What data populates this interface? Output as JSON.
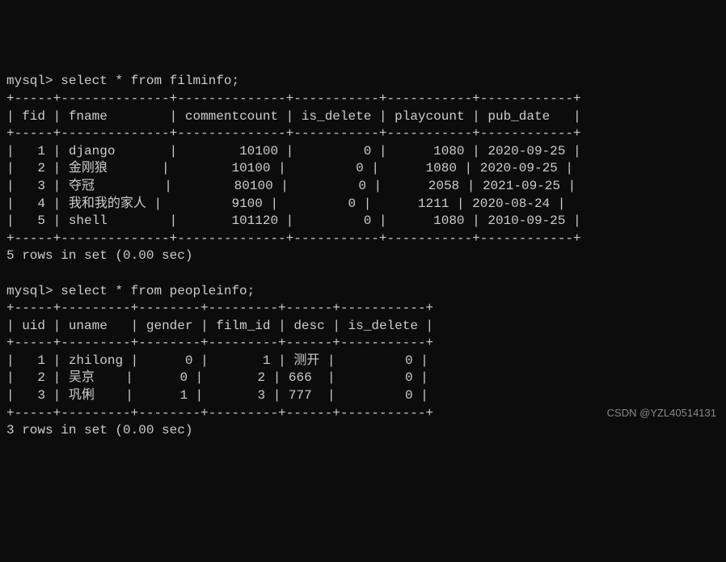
{
  "prompt": "mysql> ",
  "query1": {
    "sql": "select * from filminfo;",
    "columns": [
      "fid",
      "fname",
      "commentcount",
      "is_delete",
      "playcount",
      "pub_date"
    ],
    "rows": [
      {
        "fid": "1",
        "fname": "django",
        "commentcount": "10100",
        "is_delete": "0",
        "playcount": "1080",
        "pub_date": "2020-09-25"
      },
      {
        "fid": "2",
        "fname": "金刚狼",
        "commentcount": "10100",
        "is_delete": "0",
        "playcount": "1080",
        "pub_date": "2020-09-25"
      },
      {
        "fid": "3",
        "fname": "夺冠",
        "commentcount": "80100",
        "is_delete": "0",
        "playcount": "2058",
        "pub_date": "2021-09-25"
      },
      {
        "fid": "4",
        "fname": "我和我的家人",
        "commentcount": "9100",
        "is_delete": "0",
        "playcount": "1211",
        "pub_date": "2020-08-24"
      },
      {
        "fid": "5",
        "fname": "shell",
        "commentcount": "101120",
        "is_delete": "0",
        "playcount": "1080",
        "pub_date": "2010-09-25"
      }
    ],
    "summary": "5 rows in set (0.00 sec)"
  },
  "query2": {
    "sql": "select * from peopleinfo;",
    "columns": [
      "uid",
      "uname",
      "gender",
      "film_id",
      "desc",
      "is_delete"
    ],
    "rows": [
      {
        "uid": "1",
        "uname": "zhilong",
        "gender": "0",
        "film_id": "1",
        "desc": "测开",
        "is_delete": "0"
      },
      {
        "uid": "2",
        "uname": "吴京",
        "gender": "0",
        "film_id": "2",
        "desc": "666",
        "is_delete": "0"
      },
      {
        "uid": "3",
        "uname": "巩俐",
        "gender": "1",
        "film_id": "3",
        "desc": "777",
        "is_delete": "0"
      }
    ],
    "summary": "3 rows in set (0.00 sec)"
  },
  "watermark": "CSDN @YZL40514131"
}
